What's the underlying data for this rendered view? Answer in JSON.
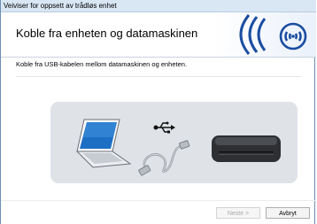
{
  "window": {
    "title": "Veiviser for oppsett av trådløs enhet"
  },
  "header": {
    "title": "Koble fra enheten og datamaskinen"
  },
  "main": {
    "instruction": "Koble fra USB-kabelen mellom datamaskinen og enheten."
  },
  "buttons": {
    "next_label": "Neste >",
    "cancel_label": "Avbryt"
  },
  "colors": {
    "logo_blue": "#1a4da1",
    "panel_bg": "#dfe3e8"
  },
  "icons": {
    "logo": "wifi-logo-icon",
    "laptop": "laptop-icon",
    "usb": "usb-icon",
    "cable": "usb-cable-icon",
    "device": "printer-device-icon"
  }
}
